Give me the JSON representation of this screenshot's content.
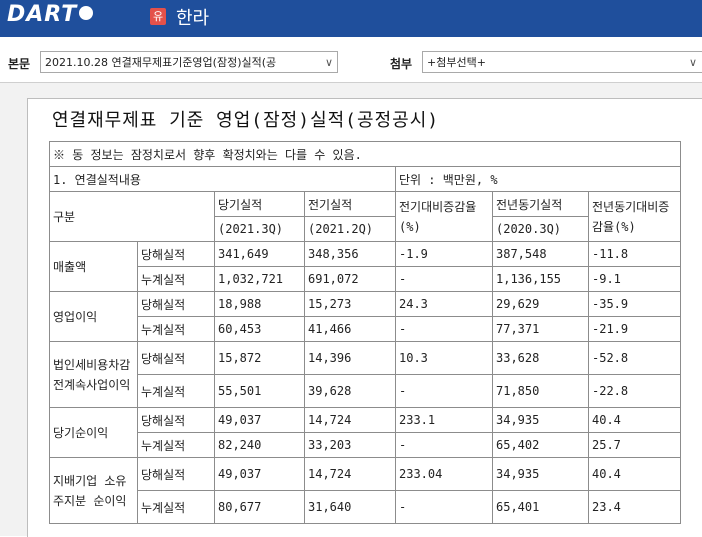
{
  "header": {
    "logo_text": "DART",
    "company_badge": "유",
    "company_name": "한라"
  },
  "docbar": {
    "main_label": "본문",
    "main_select_value": "2021.10.28  연결재무제표기준영업(잠정)실적(공",
    "attach_label": "첨부",
    "attach_select_value": "+첨부선택+"
  },
  "document": {
    "title": "연결재무제표 기준 영업(잠정)실적(공정공시)",
    "note": "※ 동 정보는 잠정치로서 향후 확정치와는 다를 수 있음.",
    "section_label": "1. 연결실적내용",
    "unit": "단위 : 백만원, %",
    "columns": {
      "category": "구분",
      "current": "당기실적",
      "current_period": "(2021.3Q)",
      "previous": "전기실적",
      "previous_period": "(2021.2Q)",
      "qoq": "전기대비증감율(%)",
      "yoy_prev": "전년동기실적",
      "yoy_period": "(2020.3Q)",
      "yoy": "전년동기대비증감율(%)"
    },
    "rows": [
      {
        "item": "매출액",
        "sub": "당해실적",
        "cur": "341,649",
        "prev": "348,356",
        "qoq": "-1.9",
        "ly": "387,548",
        "yoy": "-11.8"
      },
      {
        "item": "",
        "sub": "누계실적",
        "cur": "1,032,721",
        "prev": "691,072",
        "qoq": "-",
        "ly": "1,136,155",
        "yoy": "-9.1"
      },
      {
        "item": "영업이익",
        "sub": "당해실적",
        "cur": "18,988",
        "prev": "15,273",
        "qoq": "24.3",
        "ly": "29,629",
        "yoy": "-35.9"
      },
      {
        "item": "",
        "sub": "누계실적",
        "cur": "60,453",
        "prev": "41,466",
        "qoq": "-",
        "ly": "77,371",
        "yoy": "-21.9"
      },
      {
        "item": "법인세비용차감전계속사업이익",
        "sub": "당해실적",
        "cur": "15,872",
        "prev": "14,396",
        "qoq": "10.3",
        "ly": "33,628",
        "yoy": "-52.8"
      },
      {
        "item": "",
        "sub": "누계실적",
        "cur": "55,501",
        "prev": "39,628",
        "qoq": "-",
        "ly": "71,850",
        "yoy": "-22.8"
      },
      {
        "item": "당기순이익",
        "sub": "당해실적",
        "cur": "49,037",
        "prev": "14,724",
        "qoq": "233.1",
        "ly": "34,935",
        "yoy": "40.4"
      },
      {
        "item": "",
        "sub": "누계실적",
        "cur": "82,240",
        "prev": "33,203",
        "qoq": "-",
        "ly": "65,402",
        "yoy": "25.7"
      },
      {
        "item": "지배기업 소유주지분 순이익",
        "sub": "당해실적",
        "cur": "49,037",
        "prev": "14,724",
        "qoq": "233.04",
        "ly": "34,935",
        "yoy": "40.4"
      },
      {
        "item": "",
        "sub": "누계실적",
        "cur": "80,677",
        "prev": "31,640",
        "qoq": "-",
        "ly": "65,401",
        "yoy": "23.4"
      }
    ]
  }
}
